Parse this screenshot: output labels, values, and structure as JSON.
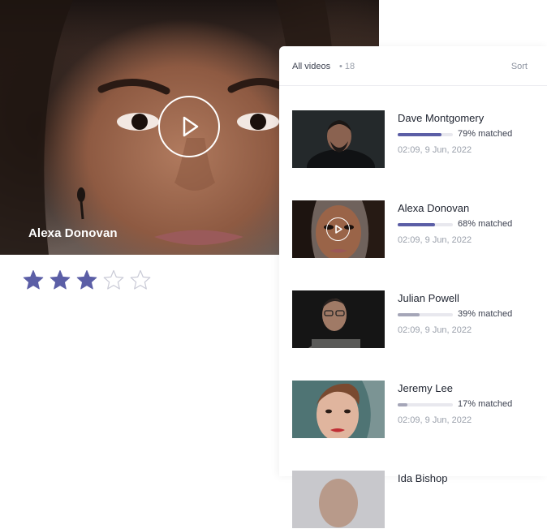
{
  "main": {
    "person_name": "Alexa Donovan",
    "rating": {
      "value": 3,
      "max": 5,
      "filled_color": "#5b5ea6",
      "empty_color": "#c9cad6"
    }
  },
  "panel": {
    "title": "All videos",
    "count_separator": "•",
    "count": "18",
    "sort_label": "Sort",
    "items": [
      {
        "name": "Dave Montgomery",
        "match_label": "79% matched",
        "match": 0.79,
        "date": "02:09, 9 Jun, 2022",
        "bar_color": "#5b5ea6",
        "playing": false
      },
      {
        "name": "Alexa Donovan",
        "match_label": "68% matched",
        "match": 0.68,
        "date": "02:09, 9 Jun, 2022",
        "bar_color": "#5b5ea6",
        "playing": true
      },
      {
        "name": "Julian Powell",
        "match_label": "39% matched",
        "match": 0.39,
        "date": "02:09, 9 Jun, 2022",
        "bar_color": "#a5a6b8",
        "playing": false
      },
      {
        "name": "Jeremy Lee",
        "match_label": "17% matched",
        "match": 0.17,
        "date": "02:09, 9 Jun, 2022",
        "bar_color": "#a5a6b8",
        "playing": false
      },
      {
        "name": "Ida Bishop",
        "match_label": "",
        "match": 0,
        "date": "",
        "bar_color": "#a5a6b8",
        "playing": false
      }
    ]
  },
  "icons": {
    "play": "play-icon",
    "star": "star-icon"
  }
}
